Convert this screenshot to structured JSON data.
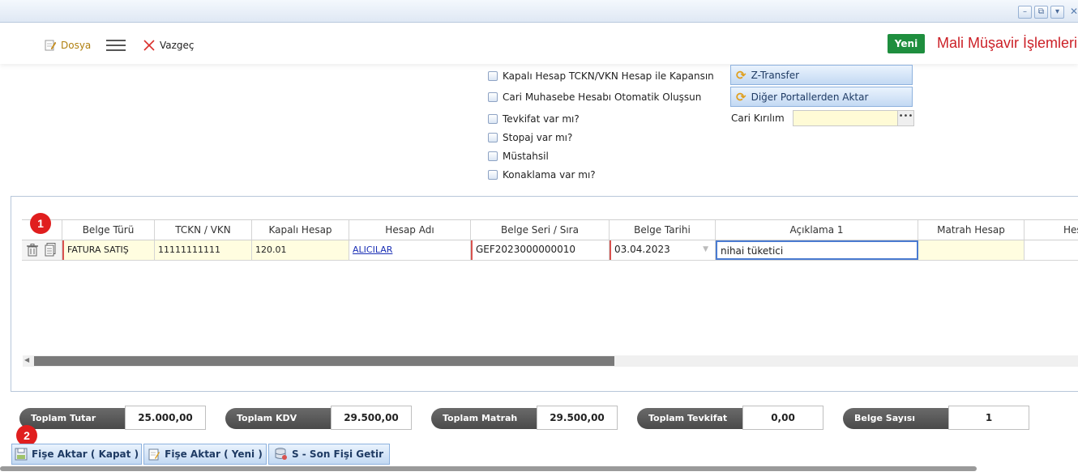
{
  "toolbar": {
    "dosya_label": "Dosya",
    "vazgec_label": "Vazgeç",
    "yeni_label": "Yeni",
    "page_title": "Mali Müşavir İşlemleri"
  },
  "options": {
    "checkboxes": [
      "Kapalı Hesap TCKN/VKN Hesap ile Kapansın",
      "Cari Muhasebe Hesabı Otomatik Oluşsun",
      "Tevkifat var mı?",
      "Stopaj var mı?",
      "Müstahsil",
      "Konaklama var mı?"
    ],
    "z_transfer_label": "Z-Transfer",
    "diger_portal_label": "Diğer Portallerden Aktar",
    "cari_kirilim_label": "Cari Kırılım",
    "cari_kirilim_value": ""
  },
  "grid": {
    "columns": [
      "Belge Türü",
      "TCKN / VKN",
      "Kapalı Hesap",
      "Hesap Adı",
      "Belge Seri / Sıra",
      "Belge Tarihi",
      "Açıklama 1",
      "Matrah Hesap",
      "Hes"
    ],
    "rows": [
      {
        "belge_turu": "FATURA SATIŞ",
        "tckn_vkn": "11111111111",
        "kapali_hesap": "120.01",
        "hesap_adi": "ALICILAR",
        "belge_seri_sira": "GEF2023000000010",
        "belge_tarihi": "03.04.2023",
        "aciklama1": "nihai tüketici",
        "matrah_hesap": ""
      }
    ]
  },
  "badges": {
    "one": "1",
    "two": "2"
  },
  "totals": [
    {
      "label": "Toplam Tutar",
      "value": "25.000,00"
    },
    {
      "label": "Toplam KDV",
      "value": "29.500,00"
    },
    {
      "label": "Toplam Matrah",
      "value": "29.500,00"
    },
    {
      "label": "Toplam Tevkifat",
      "value": "0,00"
    },
    {
      "label": "Belge Sayısı",
      "value": "1"
    }
  ],
  "buttons": {
    "fise_aktar_kapat": "Fişe Aktar ( Kapat )",
    "fise_aktar_yeni": "Fişe Aktar ( Yeni )",
    "son_fisi_getir": "S - Son Fişi Getir"
  },
  "colors": {
    "accent_red": "#cc2027",
    "yeni_green": "#1e8e3e",
    "button_blue": "#c3d9f3",
    "badge_red": "#e01e1e"
  }
}
